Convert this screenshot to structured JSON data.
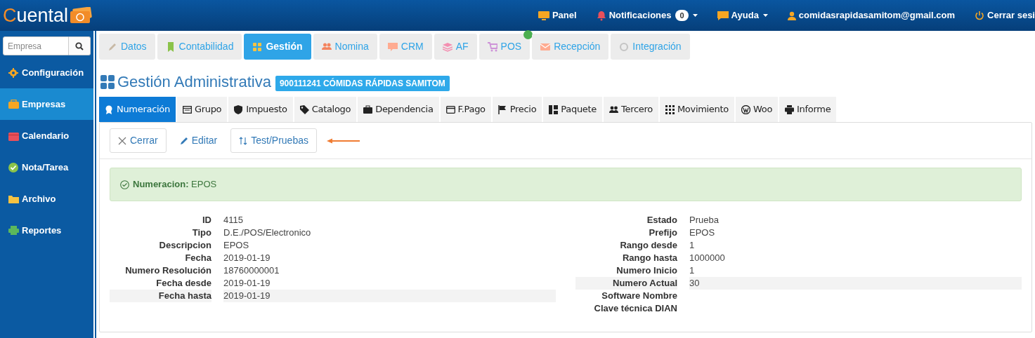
{
  "brand": {
    "first": "C",
    "rest": "uental"
  },
  "nav": [
    {
      "kind": "panel",
      "label": "Panel"
    },
    {
      "kind": "bell",
      "label": "Notificaciones",
      "count": "0"
    },
    {
      "kind": "chat",
      "label": "Ayuda"
    },
    {
      "kind": "user",
      "label": "comidasrapidasamitom@gmail.com"
    },
    {
      "kind": "power",
      "label": "Cerrar sesi"
    }
  ],
  "search": {
    "placeholder": "Empresa"
  },
  "sidebar": {
    "items": [
      {
        "label": "Configuración",
        "selected": false
      },
      {
        "label": "Empresas",
        "selected": true
      },
      {
        "label": "Calendario",
        "selected": false
      },
      {
        "label": "Nota/Tarea",
        "selected": false
      },
      {
        "label": "Archivo",
        "selected": false
      },
      {
        "label": "Reportes",
        "selected": false
      }
    ]
  },
  "modules": [
    {
      "label": "Datos",
      "selected": false,
      "dot": false
    },
    {
      "label": "Contabilidad",
      "selected": false,
      "dot": false
    },
    {
      "label": "Gestión",
      "selected": true,
      "dot": false
    },
    {
      "label": "Nomina",
      "selected": false,
      "dot": false
    },
    {
      "label": "CRM",
      "selected": false,
      "dot": false
    },
    {
      "label": "AF",
      "selected": false,
      "dot": false
    },
    {
      "label": "POS",
      "selected": false,
      "dot": true
    },
    {
      "label": "Recepción",
      "selected": false,
      "dot": false
    },
    {
      "label": "Integración",
      "selected": false,
      "dot": false
    }
  ],
  "page": {
    "title": "Gestión Administrativa",
    "company": "900111241 CÓMIDAS RÁPIDAS SAMITOM"
  },
  "tabs": [
    {
      "label": "Numeración",
      "selected": true
    },
    {
      "label": "Grupo",
      "selected": false
    },
    {
      "label": "Impuesto",
      "selected": false
    },
    {
      "label": "Catalogo",
      "selected": false
    },
    {
      "label": "Dependencia",
      "selected": false
    },
    {
      "label": "F.Pago",
      "selected": false
    },
    {
      "label": "Precio",
      "selected": false
    },
    {
      "label": "Paquete",
      "selected": false
    },
    {
      "label": "Tercero",
      "selected": false
    },
    {
      "label": "Movimiento",
      "selected": false
    },
    {
      "label": "Woo",
      "selected": false
    },
    {
      "label": "Informe",
      "selected": false
    }
  ],
  "actions": [
    {
      "kind": "close",
      "label": "Cerrar"
    },
    {
      "kind": "edit",
      "label": "Editar"
    },
    {
      "kind": "test",
      "label": "Test/Pruebas"
    }
  ],
  "alert": "**Numeracion:** EPOS",
  "left_fields": [
    {
      "label": "ID",
      "value": "4115",
      "highlighted": false
    },
    {
      "label": "Tipo",
      "value": "D.E./POS/Electronico",
      "highlighted": false
    },
    {
      "label": "Descripcion",
      "value": "EPOS",
      "highlighted": false
    },
    {
      "label": "Fecha",
      "value": "2019-01-19",
      "highlighted": false
    },
    {
      "label": "Numero Resolución",
      "value": "18760000001",
      "highlighted": false
    },
    {
      "label": "Fecha desde",
      "value": "2019-01-19",
      "highlighted": false
    },
    {
      "label": "Fecha hasta",
      "value": "2019-01-19",
      "highlighted": true
    }
  ],
  "right_fields": [
    {
      "label": "Estado",
      "value": "Prueba",
      "highlighted": false
    },
    {
      "label": "Prefijo",
      "value": "EPOS",
      "highlighted": false
    },
    {
      "label": "Rango desde",
      "value": "1",
      "highlighted": false
    },
    {
      "label": "Rango hasta",
      "value": "1000000",
      "highlighted": false
    },
    {
      "label": "Numero Inicio",
      "value": "1",
      "highlighted": false
    },
    {
      "label": "Numero Actual",
      "value": "30",
      "highlighted": true
    },
    {
      "label": "Software Nombre",
      "highlighted": false
    },
    {
      "label": "Clave técnica DIAN",
      "highlighted": false
    }
  ]
}
